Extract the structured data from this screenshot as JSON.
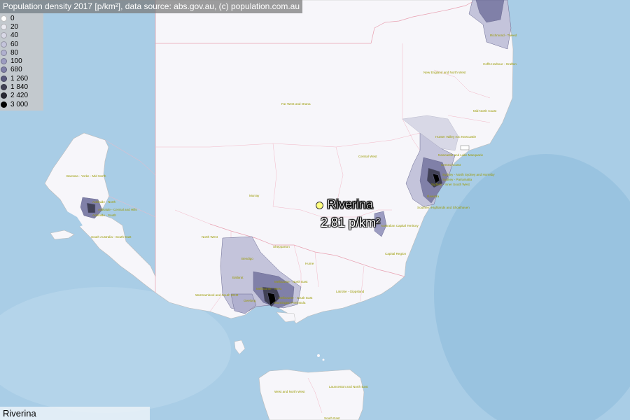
{
  "header": {
    "title": "Population density 2017 [p/km²], data source: abs.gov.au, (c) population.com.au"
  },
  "legend": {
    "items": [
      {
        "label": "0",
        "color": "#ffffff"
      },
      {
        "label": "20",
        "color": "#ebebf2"
      },
      {
        "label": "40",
        "color": "#d8d8e6"
      },
      {
        "label": "60",
        "color": "#c4c4db"
      },
      {
        "label": "80",
        "color": "#b0b0cf"
      },
      {
        "label": "100",
        "color": "#9c9cc1"
      },
      {
        "label": "680",
        "color": "#8080a8"
      },
      {
        "label": "1 260",
        "color": "#5a5a7e"
      },
      {
        "label": "1 840",
        "color": "#414156"
      },
      {
        "label": "2 420",
        "color": "#282834"
      },
      {
        "label": "3 000",
        "color": "#000000"
      }
    ]
  },
  "selected": {
    "name": "Riverina",
    "density_text": "2.81 p/km²",
    "dot_color": "#ffff80"
  },
  "footer": {
    "region": "Riverina"
  },
  "colors": {
    "sea": "#a9cde6",
    "land": "#f7f6fa",
    "region_border": "#f2b8c6",
    "label": "#9a9a00"
  },
  "region_labels": {
    "eyre": "Barossa - Yorke - Mid North",
    "far_west": "Far West and Orana",
    "central_west": "Central West",
    "new_england": "New England and North West",
    "richmond": "Richmond - Tweed",
    "coffs": "Coffs Harbour - Grafton",
    "mid_north": "Mid North Coast",
    "hunter": "Hunter Valley exc Newcastle",
    "newcastle": "Newcastle and Lake Macquarie",
    "central_coast": "Central Coast",
    "north_sydney": "Sydney - North Sydney and Hornsby",
    "parramatta": "Sydney - Parramatta",
    "inner_sw": "Sydney - Inner South West",
    "illawarra": "Illawarra",
    "southern_highlands": "Southern Highlands and Shoalhaven",
    "act": "Australian Capital Territory",
    "capital_region": "Capital Region",
    "murray": "Murray",
    "north_west": "North West",
    "shepparton": "Shepparton",
    "bendigo": "Bendigo",
    "hume": "Hume",
    "ballarat": "Ballarat",
    "melbourne_ne": "Melbourne - North East",
    "melbourne_w": "Melbourne - West",
    "warrnambool": "Warrnambool and South West",
    "melbourne_se": "Melbourne - South East",
    "mornington": "Mornington Peninsula",
    "geelong": "Geelong",
    "latrobe": "Latrobe - Gippsland",
    "sa_south_east": "South Australia - South East",
    "adelaide_north": "Adelaide - North",
    "adelaide_central": "Adelaide - Central and Hills",
    "adelaide_south": "Adelaide - South",
    "west_nw": "West and North West",
    "launceston": "Launceston and North East",
    "tas_south_east": "South East"
  }
}
